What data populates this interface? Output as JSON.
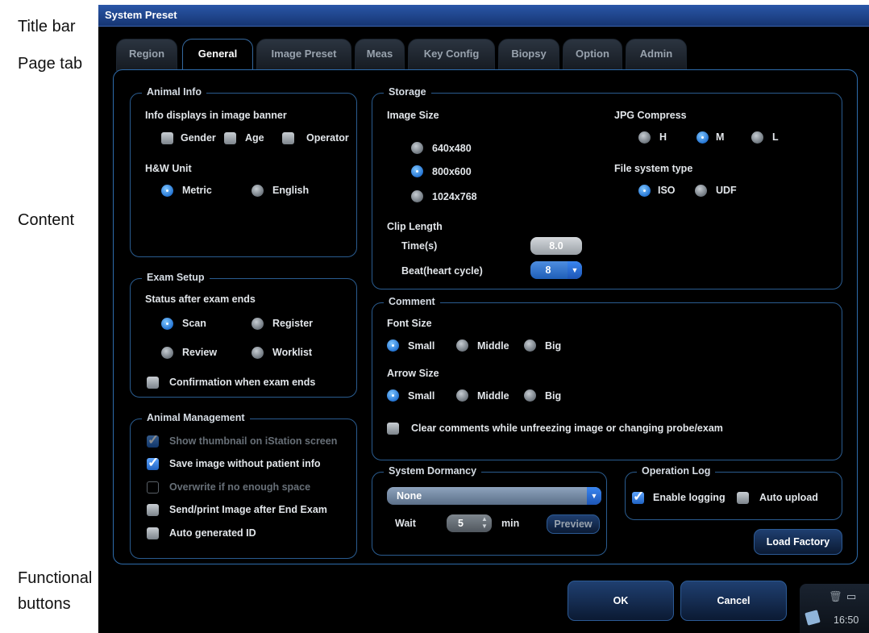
{
  "annotations": {
    "title_bar": "Title bar",
    "page_tab": "Page tab",
    "content": "Content",
    "functional_1": "Functional",
    "functional_2": "buttons"
  },
  "window": {
    "title": "System Preset"
  },
  "tabs": [
    "Region",
    "General",
    "Image Preset",
    "Meas",
    "Key Config",
    "Biopsy",
    "Option",
    "Admin"
  ],
  "active_tab": "General",
  "animal_info": {
    "title": "Animal Info",
    "banner_label": "Info displays in image banner",
    "gender": "Gender",
    "age": "Age",
    "operator": "Operator",
    "hw_label": "H&W Unit",
    "metric": "Metric",
    "english": "English",
    "selected_unit": "Metric"
  },
  "exam_setup": {
    "title": "Exam Setup",
    "status_label": "Status after exam ends",
    "scan": "Scan",
    "register": "Register",
    "review": "Review",
    "worklist": "Worklist",
    "selected_status": "Scan",
    "confirm": "Confirmation when exam ends"
  },
  "animal_mgmt": {
    "title": "Animal Management",
    "thumbnail": "Show thumbnail on iStation screen",
    "save_image": "Save image without patient info",
    "overwrite": "Overwrite if no enough space",
    "send_print": "Send/print Image after End Exam",
    "auto_id": "Auto generated ID"
  },
  "storage": {
    "title": "Storage",
    "image_size_label": "Image Size",
    "sizes": [
      "640x480",
      "800x600",
      "1024x768"
    ],
    "selected_size": "800x600",
    "jpg_label": "JPG Compress",
    "jpg_h": "H",
    "jpg_m": "M",
    "jpg_l": "L",
    "selected_jpg": "M",
    "fs_label": "File system type",
    "fs_iso": "ISO",
    "fs_udf": "UDF",
    "selected_fs": "ISO",
    "clip_label": "Clip Length",
    "time_label": "Time(s)",
    "time_value": "8.0",
    "beat_label": "Beat(heart cycle)",
    "beat_value": "8"
  },
  "comment": {
    "title": "Comment",
    "font_label": "Font Size",
    "arrow_label": "Arrow Size",
    "small": "Small",
    "middle": "Middle",
    "big": "Big",
    "selected_font": "Small",
    "selected_arrow": "Small",
    "clear": "Clear comments while unfreezing image or changing probe/exam"
  },
  "dormancy": {
    "title": "System Dormancy",
    "selected": "None",
    "wait_label": "Wait",
    "wait_value": "5",
    "min_label": "min",
    "preview": "Preview"
  },
  "oplog": {
    "title": "Operation Log",
    "enable": "Enable logging",
    "auto_upload": "Auto upload"
  },
  "buttons": {
    "load_factory": "Load Factory",
    "ok": "OK",
    "cancel": "Cancel"
  },
  "tray": {
    "time": "16:50"
  },
  "colors": {
    "titlebar": "#1e4a94",
    "accent": "#2e6cab",
    "radio_on": "#1f6fcf"
  }
}
